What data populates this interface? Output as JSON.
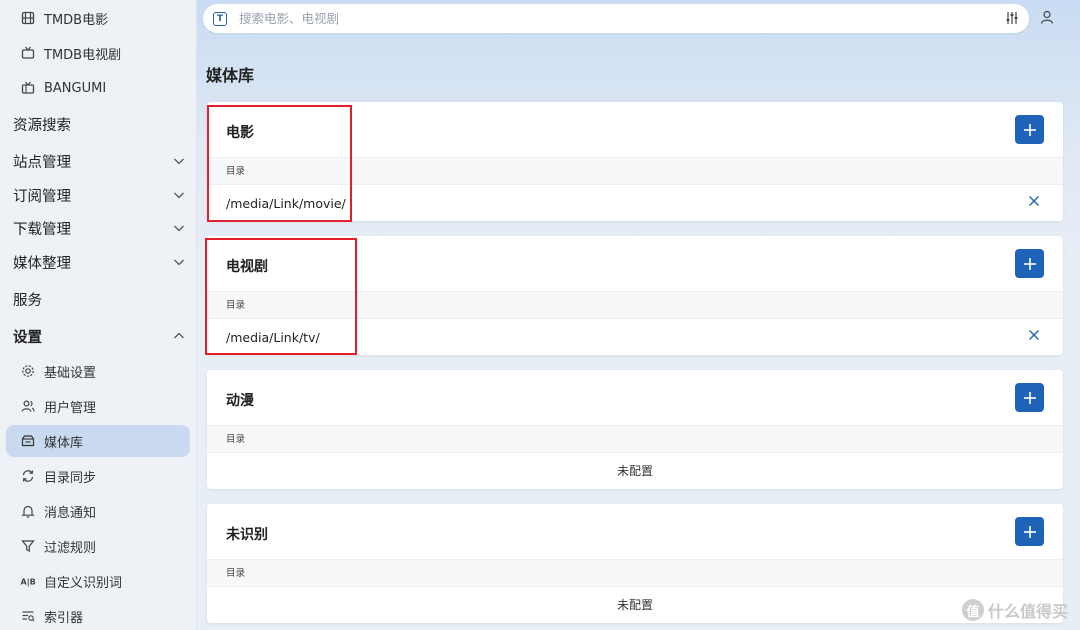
{
  "sidebar": {
    "sub_items_top": [
      {
        "label": "TMDB电影",
        "icon": "film-icon"
      },
      {
        "label": "TMDB电视剧",
        "icon": "tv-icon"
      },
      {
        "label": "BANGUMI",
        "icon": "tv-retro-icon"
      }
    ],
    "top_items": [
      {
        "label": "资源搜索"
      },
      {
        "label": "站点管理"
      },
      {
        "label": "订阅管理"
      },
      {
        "label": "下载管理"
      },
      {
        "label": "媒体整理"
      },
      {
        "label": "服务"
      },
      {
        "label": "设置"
      }
    ],
    "settings_items": [
      {
        "label": "基础设置",
        "icon": "gear-icon"
      },
      {
        "label": "用户管理",
        "icon": "users-icon"
      },
      {
        "label": "媒体库",
        "icon": "media-library-icon",
        "active": true
      },
      {
        "label": "目录同步",
        "icon": "sync-icon"
      },
      {
        "label": "消息通知",
        "icon": "bell-icon"
      },
      {
        "label": "过滤规则",
        "icon": "filter-icon"
      },
      {
        "label": "自定义识别词",
        "icon": "ab-icon"
      },
      {
        "label": "索引器",
        "icon": "index-icon"
      }
    ]
  },
  "topbar": {
    "search_placeholder": "搜索电影、电视剧"
  },
  "page": {
    "title": "媒体库"
  },
  "libraries": [
    {
      "title": "电影",
      "col_header": "目录",
      "path": "/media/Link/movie/",
      "empty": ""
    },
    {
      "title": "电视剧",
      "col_header": "目录",
      "path": "/media/Link/tv/",
      "empty": ""
    },
    {
      "title": "动漫",
      "col_header": "目录",
      "path": "",
      "empty": "未配置"
    },
    {
      "title": "未识别",
      "col_header": "目录",
      "path": "",
      "empty": "未配置"
    }
  ],
  "watermark": {
    "text": "什么值得买",
    "glyph": "值"
  },
  "colors": {
    "accent": "#1f63b8",
    "highlight": "#e0202a",
    "active_nav": "#c9daf0"
  }
}
